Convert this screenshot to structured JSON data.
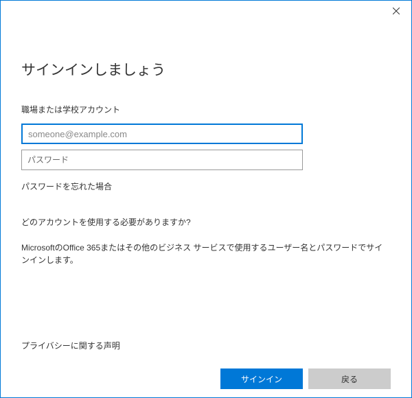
{
  "dialog": {
    "title": "サインインしましょう",
    "subtitle": "職場または学校アカウント",
    "email_placeholder": "someone@example.com",
    "password_placeholder": "パスワード",
    "forgot_password": "パスワードを忘れた場合",
    "which_account": "どのアカウントを使用する必要がありますか?",
    "info": "MicrosoftのOffice 365またはその他のビジネス サービスで使用するユーザー名とパスワードでサインインします。",
    "privacy": "プライバシーに関する声明",
    "signin_button": "サインイン",
    "back_button": "戻る"
  }
}
